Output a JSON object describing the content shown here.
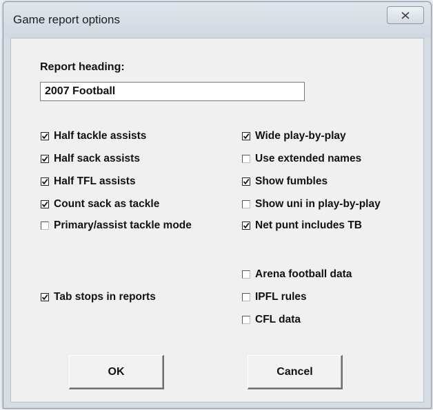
{
  "window": {
    "title": "Game report options",
    "close_glyph": "x-icon"
  },
  "report_heading": {
    "label": "Report heading:",
    "value": "2007 Football"
  },
  "left_options": [
    {
      "label": "Half tackle assists",
      "checked": true
    },
    {
      "label": "Half sack assists",
      "checked": true
    },
    {
      "label": "Half TFL assists",
      "checked": true
    },
    {
      "label": "Count sack as tackle",
      "checked": true
    },
    {
      "label": "Primary/assist tackle mode",
      "checked": false
    }
  ],
  "right_options": [
    {
      "label": "Wide play-by-play",
      "checked": true
    },
    {
      "label": "Use extended names",
      "checked": false
    },
    {
      "label": "Show fumbles",
      "checked": true
    },
    {
      "label": "Show uni in play-by-play",
      "checked": false
    },
    {
      "label": "Net punt includes TB",
      "checked": true
    }
  ],
  "tab_stops": {
    "label": "Tab stops in reports",
    "checked": true
  },
  "league_options": [
    {
      "label": "Arena football data",
      "checked": false
    },
    {
      "label": "IPFL rules",
      "checked": false
    },
    {
      "label": "CFL data",
      "checked": false
    }
  ],
  "buttons": {
    "ok": "OK",
    "cancel": "Cancel"
  }
}
